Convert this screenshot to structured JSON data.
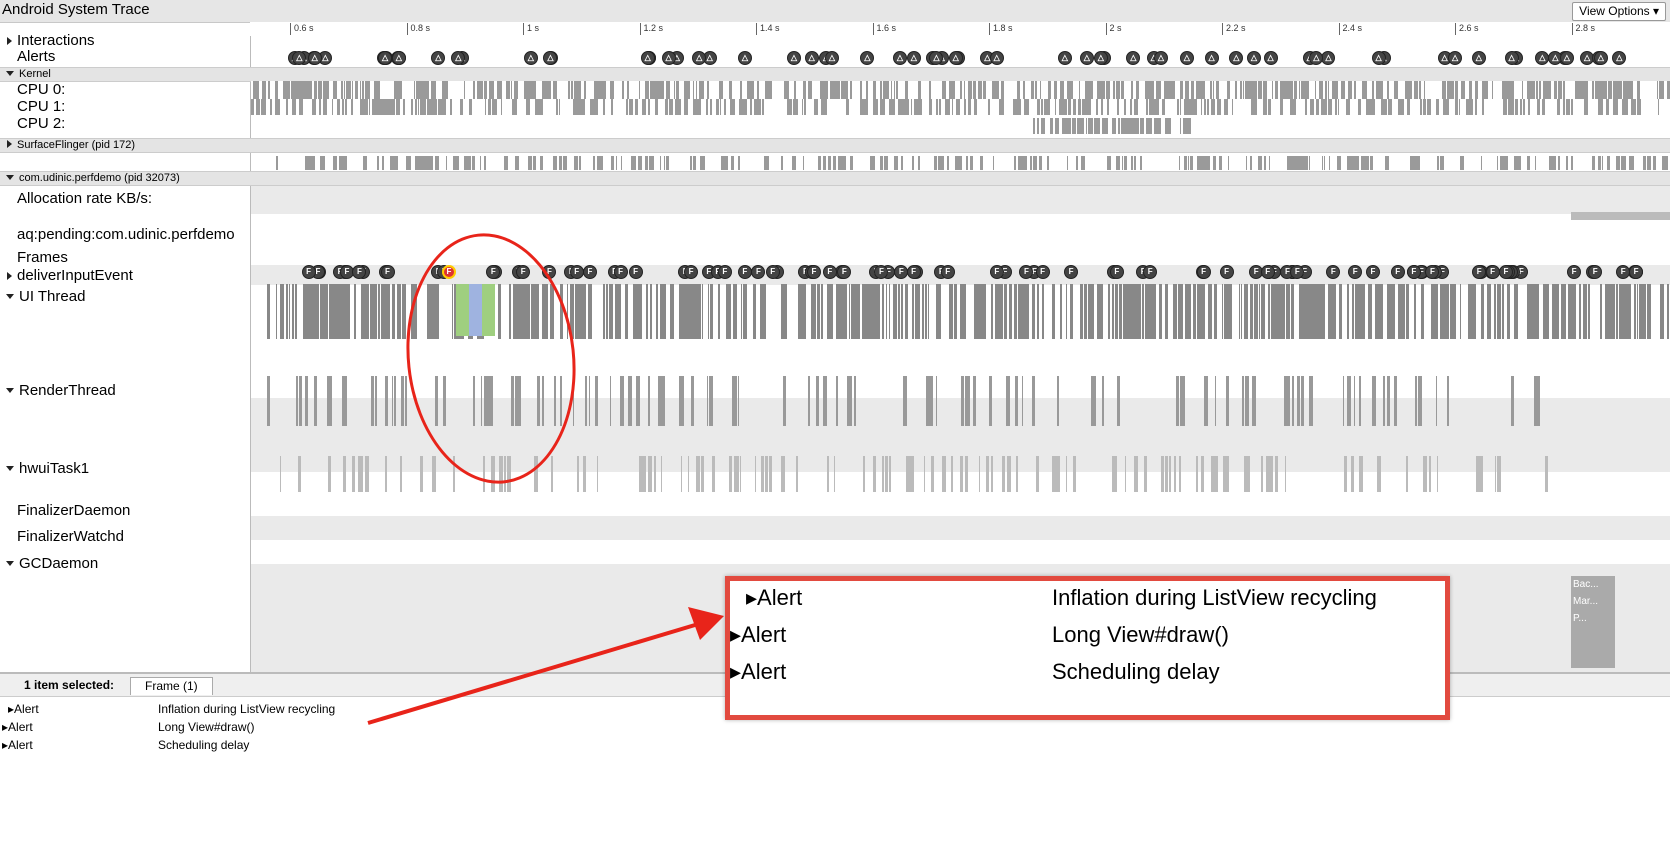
{
  "window": {
    "title": "Android System Trace",
    "view_options_label": "View Options ▾"
  },
  "ruler": {
    "ticks": [
      "0.6 s",
      "0.8 s",
      "1 s",
      "1.2 s",
      "1.4 s",
      "1.6 s",
      "1.8 s",
      "2 s",
      "2.2 s",
      "2.4 s",
      "2.6 s",
      "2.8 s"
    ]
  },
  "tracks": {
    "interactions": "Interactions",
    "alerts": "Alerts",
    "kernel": "Kernel",
    "cpu0": "CPU 0:",
    "cpu1": "CPU 1:",
    "cpu2": "CPU 2:",
    "surfaceflinger": "SurfaceFlinger (pid 172)",
    "process": "com.udinic.perfdemo (pid 32073)",
    "allocation": "Allocation rate KB/s:",
    "aq_pending": "aq:pending:com.udinic.perfdemo",
    "frames": "Frames",
    "deliver_input": "deliverInputEvent",
    "ui_thread": "UI Thread",
    "render_thread": "RenderThread",
    "hwui": "hwuiTask1",
    "finalizer_daemon": "FinalizerDaemon",
    "finalizer_watchd": "FinalizerWatchd",
    "gc_daemon": "GCDaemon"
  },
  "frame_marker": "F",
  "gc_slices": [
    "Bac...",
    "Mar...",
    "P..."
  ],
  "bottom": {
    "selection_label": "1 item selected:",
    "tab": "Frame (1)",
    "rows": [
      {
        "type": "Alert",
        "desc": "Inflation during ListView recycling"
      },
      {
        "type": "Alert",
        "desc": "Long View#draw()"
      },
      {
        "type": "Alert",
        "desc": "Scheduling delay"
      }
    ]
  },
  "colors": {
    "annotation_red": "#e24a3f",
    "slice_green": "#9fcf7f",
    "slice_blue": "#9fb3e0"
  }
}
